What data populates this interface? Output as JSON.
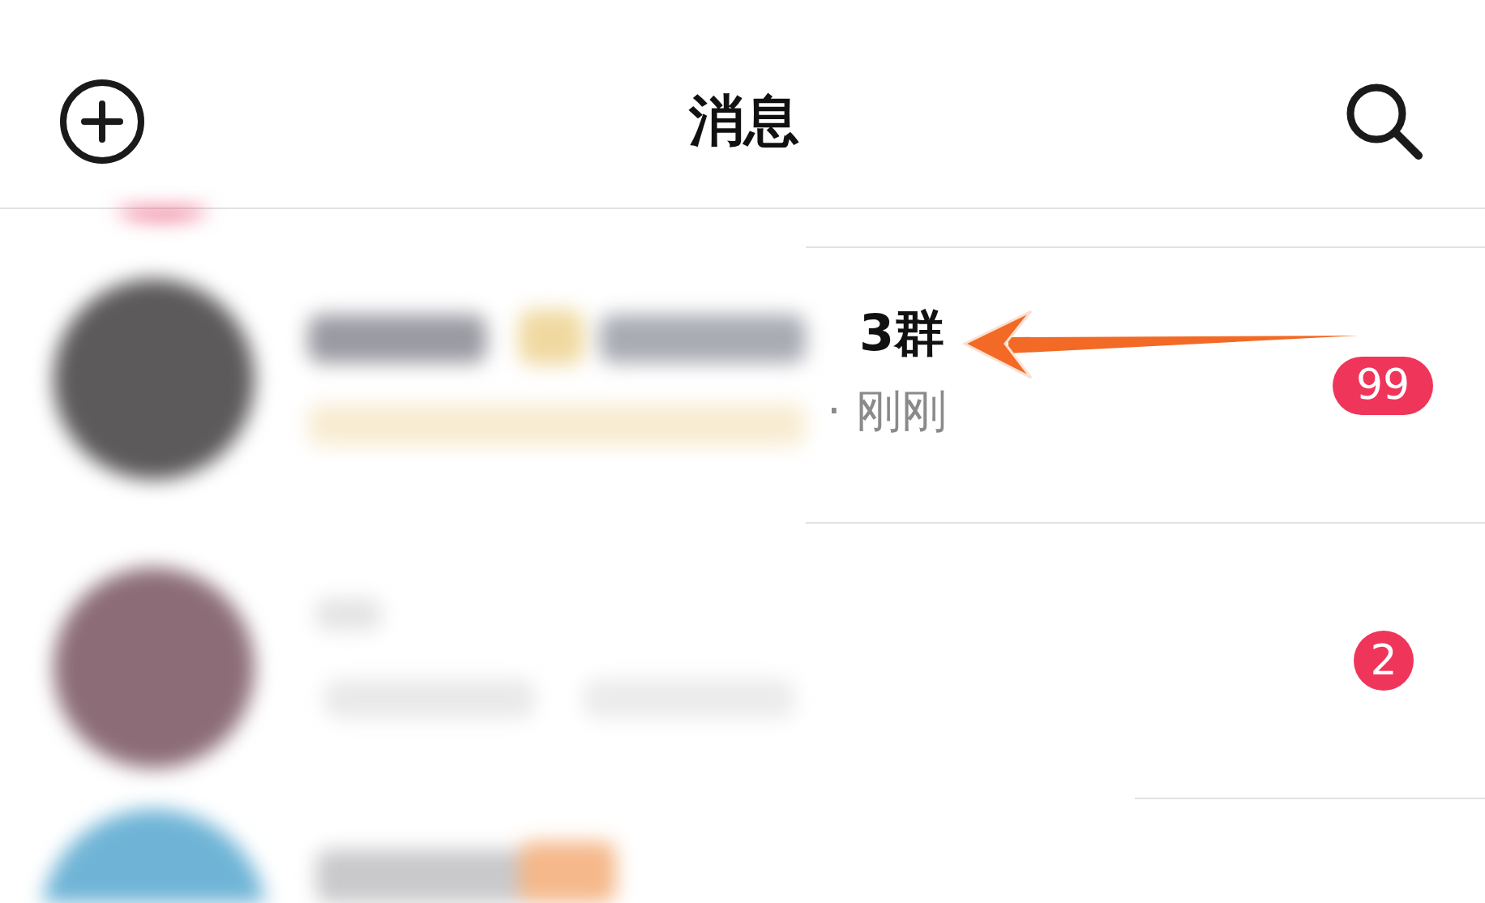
{
  "header": {
    "title": "消息"
  },
  "conversations": [
    {
      "title": "3群",
      "subtitle": "· 刚刚",
      "unread": "99"
    },
    {
      "unread": "2"
    }
  ]
}
